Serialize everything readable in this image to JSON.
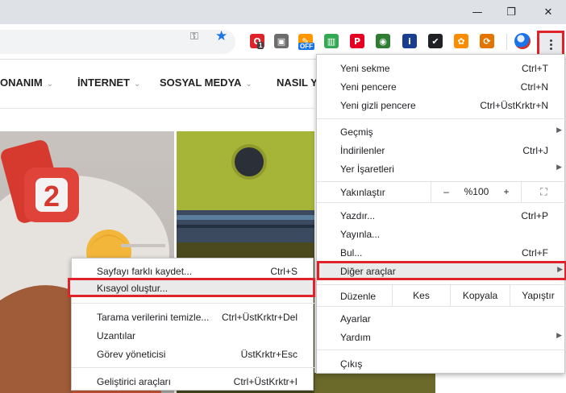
{
  "window": {
    "controls": {
      "minimize": "—",
      "restore": "❐",
      "close": "✕"
    }
  },
  "toolbar": {
    "key_icon": "⚿",
    "star_icon": "★",
    "extensions": [
      {
        "name": "opera-ext-icon",
        "glyph": "O",
        "badge": "1",
        "color": "#e0232b"
      },
      {
        "name": "sticky-ext-icon",
        "glyph": "▣",
        "badge": "",
        "color": "#6d6d6d"
      },
      {
        "name": "off-ext-icon",
        "glyph": "✎",
        "badge": "OFF",
        "color": "#ff9800"
      },
      {
        "name": "chart-ext-icon",
        "glyph": "▥",
        "badge": "",
        "color": "#34a853"
      },
      {
        "name": "pinterest-ext-icon",
        "glyph": "P",
        "badge": "",
        "color": "#e60023"
      },
      {
        "name": "globe-ext-icon",
        "glyph": "◉",
        "badge": "",
        "color": "#2e7d32"
      },
      {
        "name": "info-ext-icon",
        "glyph": "i",
        "badge": "",
        "color": "#1a3e8f"
      },
      {
        "name": "check-ext-icon",
        "glyph": "✔",
        "badge": "",
        "color": "#202124"
      },
      {
        "name": "flower-ext-icon",
        "glyph": "✿",
        "badge": "",
        "color": "#fb8c00"
      },
      {
        "name": "sync-ext-icon",
        "glyph": "⟳",
        "badge": "",
        "color": "#e37400"
      }
    ]
  },
  "site": {
    "nav": [
      {
        "label": "ONANIM"
      },
      {
        "label": "İNTERNET"
      },
      {
        "label": "SOSYAL MEDYA"
      },
      {
        "label": "NASIL YAPILIR"
      }
    ],
    "chevron": "⌄",
    "hero_number": "2"
  },
  "menu": {
    "new_tab": "Yeni sekme",
    "new_tab_sc": "Ctrl+T",
    "new_window": "Yeni pencere",
    "new_window_sc": "Ctrl+N",
    "incognito": "Yeni gizli pencere",
    "incognito_sc": "Ctrl+ÜstKrktr+N",
    "history": "Geçmiş",
    "downloads": "İndirilenler",
    "downloads_sc": "Ctrl+J",
    "bookmarks": "Yer İşaretleri",
    "zoom": "Yakınlaştır",
    "zoom_minus": "–",
    "zoom_value": "%100",
    "zoom_plus": "+",
    "fullscreen_icon": "⛶",
    "print": "Yazdır...",
    "print_sc": "Ctrl+P",
    "cast": "Yayınla...",
    "find": "Bul...",
    "find_sc": "Ctrl+F",
    "more_tools": "Diğer araçlar",
    "edit": "Düzenle",
    "cut": "Kes",
    "copy": "Kopyala",
    "paste": "Yapıştır",
    "settings": "Ayarlar",
    "help": "Yardım",
    "exit": "Çıkış",
    "arrow": "▶"
  },
  "submenu": {
    "save_page": "Sayfayı farklı kaydet...",
    "save_page_sc": "Ctrl+S",
    "create_shortcut": "Kısayol oluştur...",
    "clear_data": "Tarama verilerini temizle...",
    "clear_data_sc": "Ctrl+ÜstKrktr+Del",
    "extensions": "Uzantılar",
    "task_manager": "Görev yöneticisi",
    "task_manager_sc": "ÜstKrktr+Esc",
    "dev_tools": "Geliştirici araçları",
    "dev_tools_sc": "Ctrl+ÜstKrktr+I"
  }
}
